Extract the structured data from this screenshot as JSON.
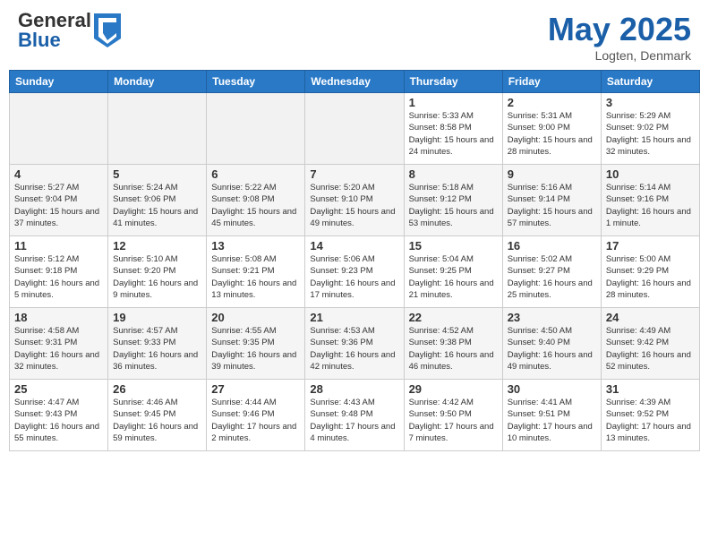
{
  "header": {
    "logo_general": "General",
    "logo_blue": "Blue",
    "month_title": "May 2025",
    "location": "Logten, Denmark"
  },
  "calendar": {
    "days_of_week": [
      "Sunday",
      "Monday",
      "Tuesday",
      "Wednesday",
      "Thursday",
      "Friday",
      "Saturday"
    ],
    "weeks": [
      [
        {
          "day": "",
          "empty": true
        },
        {
          "day": "",
          "empty": true
        },
        {
          "day": "",
          "empty": true
        },
        {
          "day": "",
          "empty": true
        },
        {
          "day": "1",
          "sunrise": "5:33 AM",
          "sunset": "8:58 PM",
          "daylight": "15 hours and 24 minutes."
        },
        {
          "day": "2",
          "sunrise": "5:31 AM",
          "sunset": "9:00 PM",
          "daylight": "15 hours and 28 minutes."
        },
        {
          "day": "3",
          "sunrise": "5:29 AM",
          "sunset": "9:02 PM",
          "daylight": "15 hours and 32 minutes."
        }
      ],
      [
        {
          "day": "4",
          "sunrise": "5:27 AM",
          "sunset": "9:04 PM",
          "daylight": "15 hours and 37 minutes."
        },
        {
          "day": "5",
          "sunrise": "5:24 AM",
          "sunset": "9:06 PM",
          "daylight": "15 hours and 41 minutes."
        },
        {
          "day": "6",
          "sunrise": "5:22 AM",
          "sunset": "9:08 PM",
          "daylight": "15 hours and 45 minutes."
        },
        {
          "day": "7",
          "sunrise": "5:20 AM",
          "sunset": "9:10 PM",
          "daylight": "15 hours and 49 minutes."
        },
        {
          "day": "8",
          "sunrise": "5:18 AM",
          "sunset": "9:12 PM",
          "daylight": "15 hours and 53 minutes."
        },
        {
          "day": "9",
          "sunrise": "5:16 AM",
          "sunset": "9:14 PM",
          "daylight": "15 hours and 57 minutes."
        },
        {
          "day": "10",
          "sunrise": "5:14 AM",
          "sunset": "9:16 PM",
          "daylight": "16 hours and 1 minute."
        }
      ],
      [
        {
          "day": "11",
          "sunrise": "5:12 AM",
          "sunset": "9:18 PM",
          "daylight": "16 hours and 5 minutes."
        },
        {
          "day": "12",
          "sunrise": "5:10 AM",
          "sunset": "9:20 PM",
          "daylight": "16 hours and 9 minutes."
        },
        {
          "day": "13",
          "sunrise": "5:08 AM",
          "sunset": "9:21 PM",
          "daylight": "16 hours and 13 minutes."
        },
        {
          "day": "14",
          "sunrise": "5:06 AM",
          "sunset": "9:23 PM",
          "daylight": "16 hours and 17 minutes."
        },
        {
          "day": "15",
          "sunrise": "5:04 AM",
          "sunset": "9:25 PM",
          "daylight": "16 hours and 21 minutes."
        },
        {
          "day": "16",
          "sunrise": "5:02 AM",
          "sunset": "9:27 PM",
          "daylight": "16 hours and 25 minutes."
        },
        {
          "day": "17",
          "sunrise": "5:00 AM",
          "sunset": "9:29 PM",
          "daylight": "16 hours and 28 minutes."
        }
      ],
      [
        {
          "day": "18",
          "sunrise": "4:58 AM",
          "sunset": "9:31 PM",
          "daylight": "16 hours and 32 minutes."
        },
        {
          "day": "19",
          "sunrise": "4:57 AM",
          "sunset": "9:33 PM",
          "daylight": "16 hours and 36 minutes."
        },
        {
          "day": "20",
          "sunrise": "4:55 AM",
          "sunset": "9:35 PM",
          "daylight": "16 hours and 39 minutes."
        },
        {
          "day": "21",
          "sunrise": "4:53 AM",
          "sunset": "9:36 PM",
          "daylight": "16 hours and 42 minutes."
        },
        {
          "day": "22",
          "sunrise": "4:52 AM",
          "sunset": "9:38 PM",
          "daylight": "16 hours and 46 minutes."
        },
        {
          "day": "23",
          "sunrise": "4:50 AM",
          "sunset": "9:40 PM",
          "daylight": "16 hours and 49 minutes."
        },
        {
          "day": "24",
          "sunrise": "4:49 AM",
          "sunset": "9:42 PM",
          "daylight": "16 hours and 52 minutes."
        }
      ],
      [
        {
          "day": "25",
          "sunrise": "4:47 AM",
          "sunset": "9:43 PM",
          "daylight": "16 hours and 55 minutes."
        },
        {
          "day": "26",
          "sunrise": "4:46 AM",
          "sunset": "9:45 PM",
          "daylight": "16 hours and 59 minutes."
        },
        {
          "day": "27",
          "sunrise": "4:44 AM",
          "sunset": "9:46 PM",
          "daylight": "17 hours and 2 minutes."
        },
        {
          "day": "28",
          "sunrise": "4:43 AM",
          "sunset": "9:48 PM",
          "daylight": "17 hours and 4 minutes."
        },
        {
          "day": "29",
          "sunrise": "4:42 AM",
          "sunset": "9:50 PM",
          "daylight": "17 hours and 7 minutes."
        },
        {
          "day": "30",
          "sunrise": "4:41 AM",
          "sunset": "9:51 PM",
          "daylight": "17 hours and 10 minutes."
        },
        {
          "day": "31",
          "sunrise": "4:39 AM",
          "sunset": "9:52 PM",
          "daylight": "17 hours and 13 minutes."
        }
      ]
    ]
  }
}
